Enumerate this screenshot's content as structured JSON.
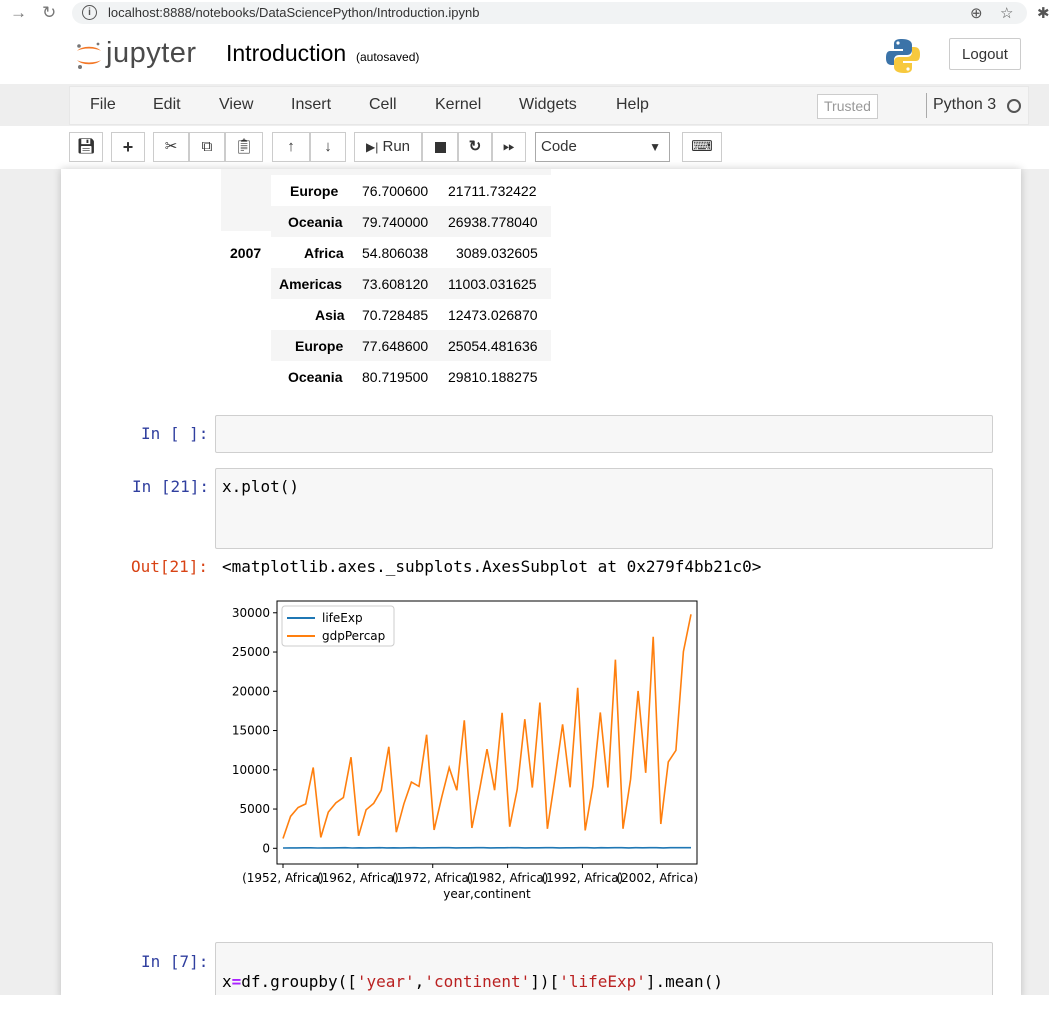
{
  "browser": {
    "url": "localhost:8888/notebooks/DataSciencePython/Introduction.ipynb"
  },
  "header": {
    "logo_text": "jupyter",
    "notebook_title": "Introduction",
    "autosave_status": "(autosaved)",
    "logout_label": "Logout"
  },
  "menu": {
    "items": [
      "File",
      "Edit",
      "View",
      "Insert",
      "Cell",
      "Kernel",
      "Widgets",
      "Help"
    ],
    "trusted_label": "Trusted",
    "kernel_name": "Python 3"
  },
  "toolbar": {
    "run_label": "Run",
    "cell_type": "Code"
  },
  "table": {
    "rows": [
      {
        "year": "",
        "continent": "Europe",
        "lifeExp": "76.700600",
        "gdpPercap": "21711.732422"
      },
      {
        "year": "",
        "continent": "Oceania",
        "lifeExp": "79.740000",
        "gdpPercap": "26938.778040"
      },
      {
        "year": "2007",
        "continent": "Africa",
        "lifeExp": "54.806038",
        "gdpPercap": "3089.032605"
      },
      {
        "year": "",
        "continent": "Americas",
        "lifeExp": "73.608120",
        "gdpPercap": "11003.031625"
      },
      {
        "year": "",
        "continent": "Asia",
        "lifeExp": "70.728485",
        "gdpPercap": "12473.026870"
      },
      {
        "year": "",
        "continent": "Europe",
        "lifeExp": "77.648600",
        "gdpPercap": "25054.481636"
      },
      {
        "year": "",
        "continent": "Oceania",
        "lifeExp": "80.719500",
        "gdpPercap": "29810.188275"
      }
    ]
  },
  "cells": {
    "empty_prompt": "In [ ]:",
    "plot_prompt": "In [21]:",
    "plot_code": "x.plot()",
    "out_prompt": "Out[21]:",
    "out_text": "<matplotlib.axes._subplots.AxesSubplot at 0x279f4bb21c0>",
    "last_prompt": "In [7]:",
    "last_code": {
      "p1": "x",
      "p2": "=",
      "p3": "df.groupby([",
      "p4": "'year'",
      "p5": ",",
      "p6": "'continent'",
      "p7": "])[",
      "p8": "'lifeExp'",
      "p9": "].mean()"
    }
  },
  "chart_data": {
    "type": "line",
    "title": "",
    "xlabel": "year,continent",
    "ylabel": "",
    "xtick_labels": [
      "(1952, Africa)",
      "(1962, Africa)",
      "(1972, Africa)",
      "(1982, Africa)",
      "(1992, Africa)",
      "(2002, Africa)"
    ],
    "yticks": [
      0,
      5000,
      10000,
      15000,
      20000,
      25000,
      30000
    ],
    "ylim": [
      -2000,
      31500
    ],
    "legend_position": "upper-left",
    "grid": false,
    "series": [
      {
        "name": "lifeExp",
        "color": "#1f77b4",
        "values": [
          39.1,
          53.3,
          46.3,
          64.4,
          69.1,
          41.3,
          55.8,
          49.3,
          66.3,
          70.0,
          43.3,
          58.4,
          51.6,
          68.7,
          71.3,
          45.3,
          60.4,
          54.2,
          69.7,
          71.6,
          47.5,
          62.4,
          57.3,
          70.8,
          72.0,
          49.6,
          64.4,
          59.6,
          72.0,
          72.6,
          51.6,
          66.2,
          62.6,
          73.7,
          73.0,
          53.3,
          68.1,
          63.9,
          74.6,
          74.3,
          53.6,
          69.6,
          66.1,
          75.5,
          75.7,
          53.6,
          71.2,
          67.5,
          76.2,
          76.2,
          53.3,
          72.4,
          68.7,
          76.7,
          79.7,
          54.8,
          73.6,
          70.7,
          77.6,
          80.7
        ]
      },
      {
        "name": "gdpPercap",
        "color": "#ff7f0e",
        "values": [
          1253,
          4079,
          5195,
          5661,
          10298,
          1385,
          4616,
          5788,
          6469,
          11599,
          1598,
          4902,
          5729,
          7390,
          12923,
          2050,
          5668,
          8434,
          7879,
          14469,
          2339,
          6491,
          10281,
          7387,
          16299,
          2586,
          7352,
          12633,
          7402,
          17262,
          2757,
          7507,
          16442,
          7728,
          18555,
          2482,
          8889,
          15795,
          7770,
          20448,
          2283,
          7887,
          17295,
          7739,
          24024,
          2493,
          8796,
          20041,
          9617,
          26939,
          3089,
          11003,
          12473,
          25054,
          29810
        ]
      }
    ]
  }
}
